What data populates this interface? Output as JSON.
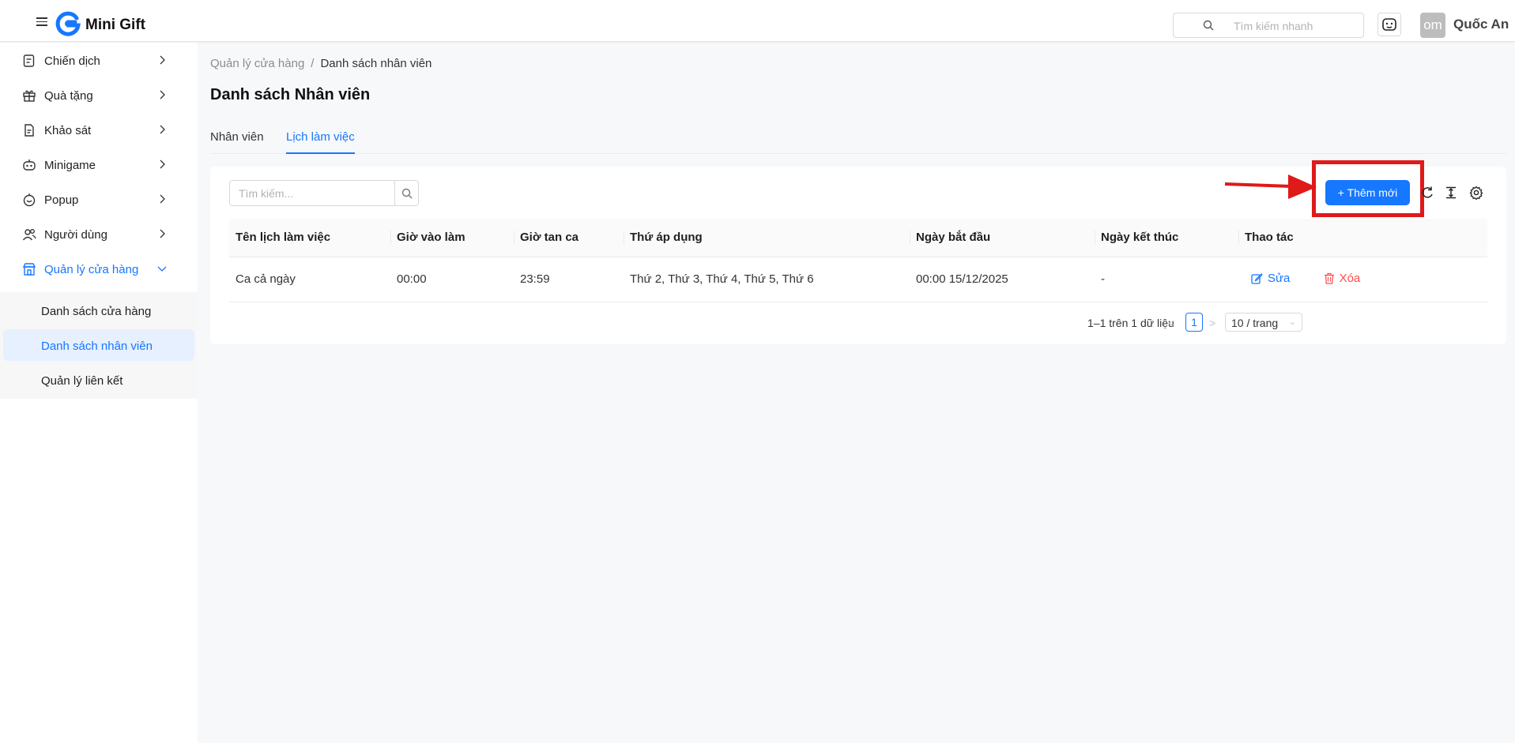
{
  "app": {
    "brand": "Mini Gift"
  },
  "header": {
    "search_placeholder": "Tìm kiếm nhanh",
    "avatar_text": "om",
    "username": "Quốc An"
  },
  "sidebar": {
    "items": [
      {
        "label": "Chiến dịch",
        "icon": "campaign-icon"
      },
      {
        "label": "Quà tặng",
        "icon": "gift-icon"
      },
      {
        "label": "Khảo sát",
        "icon": "survey-icon"
      },
      {
        "label": "Minigame",
        "icon": "game-icon"
      },
      {
        "label": "Popup",
        "icon": "popup-icon"
      },
      {
        "label": "Người dùng",
        "icon": "users-icon"
      },
      {
        "label": "Quản lý cửa hàng",
        "icon": "store-icon"
      }
    ],
    "subitems": [
      {
        "label": "Danh sách cửa hàng"
      },
      {
        "label": "Danh sách nhân viên"
      },
      {
        "label": "Quản lý liên kết"
      }
    ]
  },
  "breadcrumb": {
    "parent": "Quản lý cửa hàng",
    "separator": "/",
    "current": "Danh sách nhân viên"
  },
  "page": {
    "title": "Danh sách Nhân viên"
  },
  "tabs": [
    {
      "label": "Nhân viên"
    },
    {
      "label": "Lịch làm việc"
    }
  ],
  "toolbar": {
    "search_placeholder": "Tìm kiếm...",
    "add_label": "+ Thêm mới"
  },
  "table": {
    "columns": [
      "Tên lịch làm việc",
      "Giờ vào làm",
      "Giờ tan ca",
      "Thứ áp dụng",
      "Ngày bắt đầu",
      "Ngày kết thúc",
      "Thao tác"
    ],
    "rows": [
      {
        "name": "Ca cả ngày",
        "start_time": "00:00",
        "end_time": "23:59",
        "days": "Thứ 2, Thứ 3, Thứ 4, Thứ 5, Thứ 6",
        "start_date": "00:00 15/12/2025",
        "end_date": "-",
        "edit_label": "Sửa",
        "delete_label": "Xóa"
      }
    ]
  },
  "pagination": {
    "total_text": "1–1 trên 1 dữ liệu",
    "current_page": "1",
    "page_size": "10 / trang"
  },
  "colors": {
    "accent": "#1677ff",
    "danger": "#ff4d4f",
    "highlight": "#e01919"
  }
}
